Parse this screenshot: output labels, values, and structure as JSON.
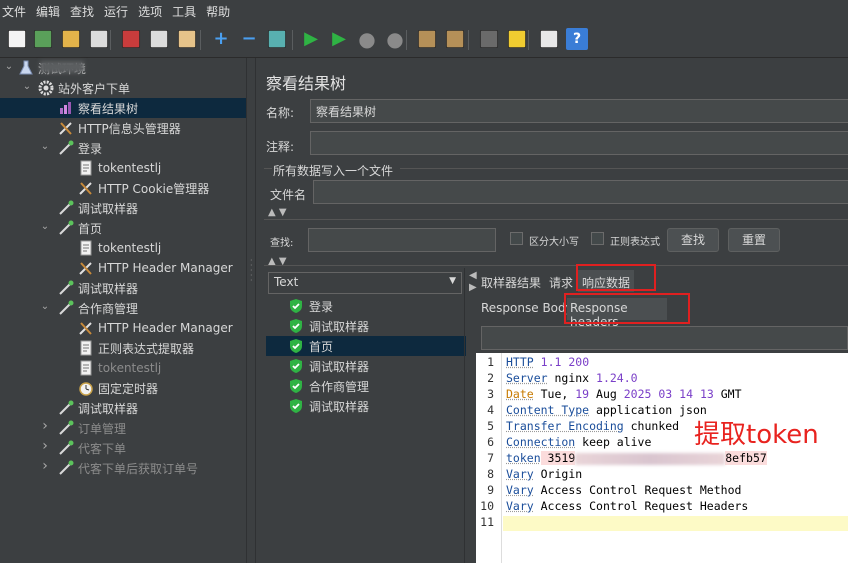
{
  "menu": [
    "文件",
    "编辑",
    "查找",
    "运行",
    "选项",
    "工具",
    "帮助"
  ],
  "toolbar": [
    "new-icon",
    "templates-icon",
    "open-icon",
    "save-icon",
    "cut-icon",
    "copy-icon",
    "paste-icon",
    "expand-icon",
    "collapse-icon",
    "toggle-icon",
    "start-icon",
    "start-no-pause-icon",
    "stop-icon",
    "shutdown-icon",
    "clear-icon",
    "clear-all-icon",
    "search-icon",
    "reset-search-icon",
    "function-helper-icon",
    "help-icon"
  ],
  "tree": {
    "root": "测试环境",
    "group": "站外客户下单",
    "items": [
      {
        "label": "察看结果树",
        "depth": 2,
        "icon": "listener",
        "selected": true
      },
      {
        "label": "HTTP信息头管理器",
        "depth": 2,
        "icon": "config"
      },
      {
        "label": "登录",
        "depth": 2,
        "icon": "sampler",
        "expand": "v"
      },
      {
        "label": "tokentestlj",
        "depth": 3,
        "icon": "doc"
      },
      {
        "label": "HTTP Cookie管理器",
        "depth": 3,
        "icon": "config"
      },
      {
        "label": "调试取样器",
        "depth": 2,
        "icon": "sampler"
      },
      {
        "label": "首页",
        "depth": 2,
        "icon": "sampler",
        "expand": "v"
      },
      {
        "label": "tokentestlj",
        "depth": 3,
        "icon": "doc"
      },
      {
        "label": "HTTP Header Manager",
        "depth": 3,
        "icon": "config"
      },
      {
        "label": "调试取样器",
        "depth": 2,
        "icon": "sampler"
      },
      {
        "label": "合作商管理",
        "depth": 2,
        "icon": "sampler",
        "expand": "v"
      },
      {
        "label": "HTTP Header Manager",
        "depth": 3,
        "icon": "config"
      },
      {
        "label": "正则表达式提取器",
        "depth": 3,
        "icon": "doc"
      },
      {
        "label": "tokentestlj",
        "depth": 3,
        "icon": "doc",
        "disabled": true
      },
      {
        "label": "固定定时器",
        "depth": 3,
        "icon": "timer"
      },
      {
        "label": "调试取样器",
        "depth": 2,
        "icon": "sampler"
      },
      {
        "label": "订单管理",
        "depth": 2,
        "icon": "sampler",
        "expand": ">",
        "disabled": true
      },
      {
        "label": "代客下单",
        "depth": 2,
        "icon": "sampler",
        "expand": ">",
        "disabled": true
      },
      {
        "label": "代客下单后获取订单号",
        "depth": 2,
        "icon": "sampler",
        "expand": ">",
        "disabled": true
      }
    ]
  },
  "panel": {
    "title": "察看结果树",
    "name_label": "名称:",
    "name_value": "察看结果树",
    "comment_label": "注释:",
    "comment_value": "",
    "file_section": "所有数据写入一个文件",
    "filename_label": "文件名",
    "filename_value": "",
    "search_label": "查找:",
    "search_value": "",
    "case_label": "区分大小写",
    "regex_label": "正则表达式",
    "find_btn": "查找",
    "reset_btn": "重置",
    "renderer": "Text"
  },
  "results": [
    {
      "label": "登录"
    },
    {
      "label": "调试取样器"
    },
    {
      "label": "首页",
      "selected": true
    },
    {
      "label": "调试取样器"
    },
    {
      "label": "合作商管理"
    },
    {
      "label": "调试取样器"
    }
  ],
  "tabs": {
    "sampler_result": "取样器结果",
    "request": "请求",
    "response": "响应数据"
  },
  "subtabs": {
    "body": "Response Body",
    "headers": "Response headers"
  },
  "annotation": "提取token",
  "code": [
    {
      "n": "1",
      "k": "HTTP",
      "v": " 1.1 200"
    },
    {
      "n": "2",
      "k": "Server",
      "v": " nginx 1.24.0"
    },
    {
      "n": "3",
      "k": "Date",
      "v": " Tue, 19 Aug 2025 03 14 13 GMT"
    },
    {
      "n": "4",
      "k": "Content Type",
      "v": " application json"
    },
    {
      "n": "5",
      "k": "Transfer Encoding",
      "v": " chunked"
    },
    {
      "n": "6",
      "k": "Connection",
      "v": " keep alive"
    },
    {
      "n": "7",
      "k": "token",
      "v": " 3519",
      "tail": "8efb57"
    },
    {
      "n": "8",
      "k": "Vary",
      "v": " Origin"
    },
    {
      "n": "9",
      "k": "Vary",
      "v": " Access Control Request Method"
    },
    {
      "n": "10",
      "k": "Vary",
      "v": " Access Control Request Headers"
    },
    {
      "n": "11",
      "k": "",
      "v": ""
    }
  ]
}
